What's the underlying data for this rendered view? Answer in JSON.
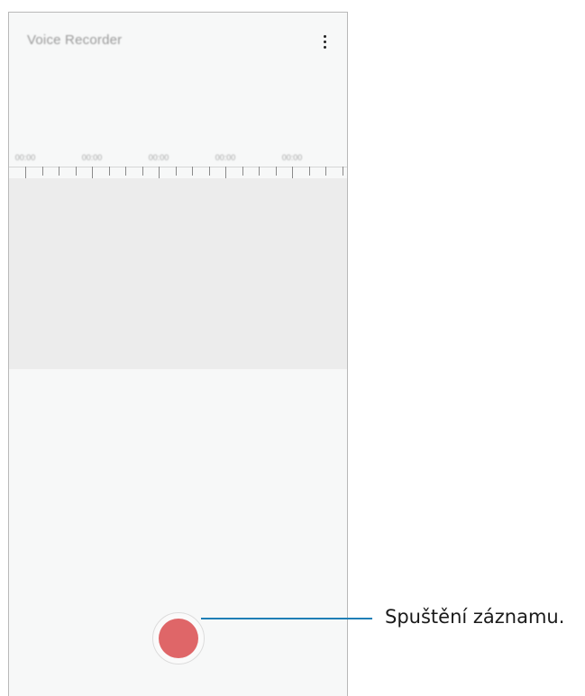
{
  "app": {
    "title": "Voice Recorder",
    "more_icon": "more-vertical-icon"
  },
  "timeline": {
    "labels": [
      "00:00",
      "00:00",
      "00:00",
      "00:00",
      "00:00"
    ]
  },
  "record_button": {
    "icon": "record-icon",
    "color": "#df6668"
  },
  "callout": {
    "text": "Spuštění záznamu.",
    "line_color": "#1f7fb6"
  }
}
